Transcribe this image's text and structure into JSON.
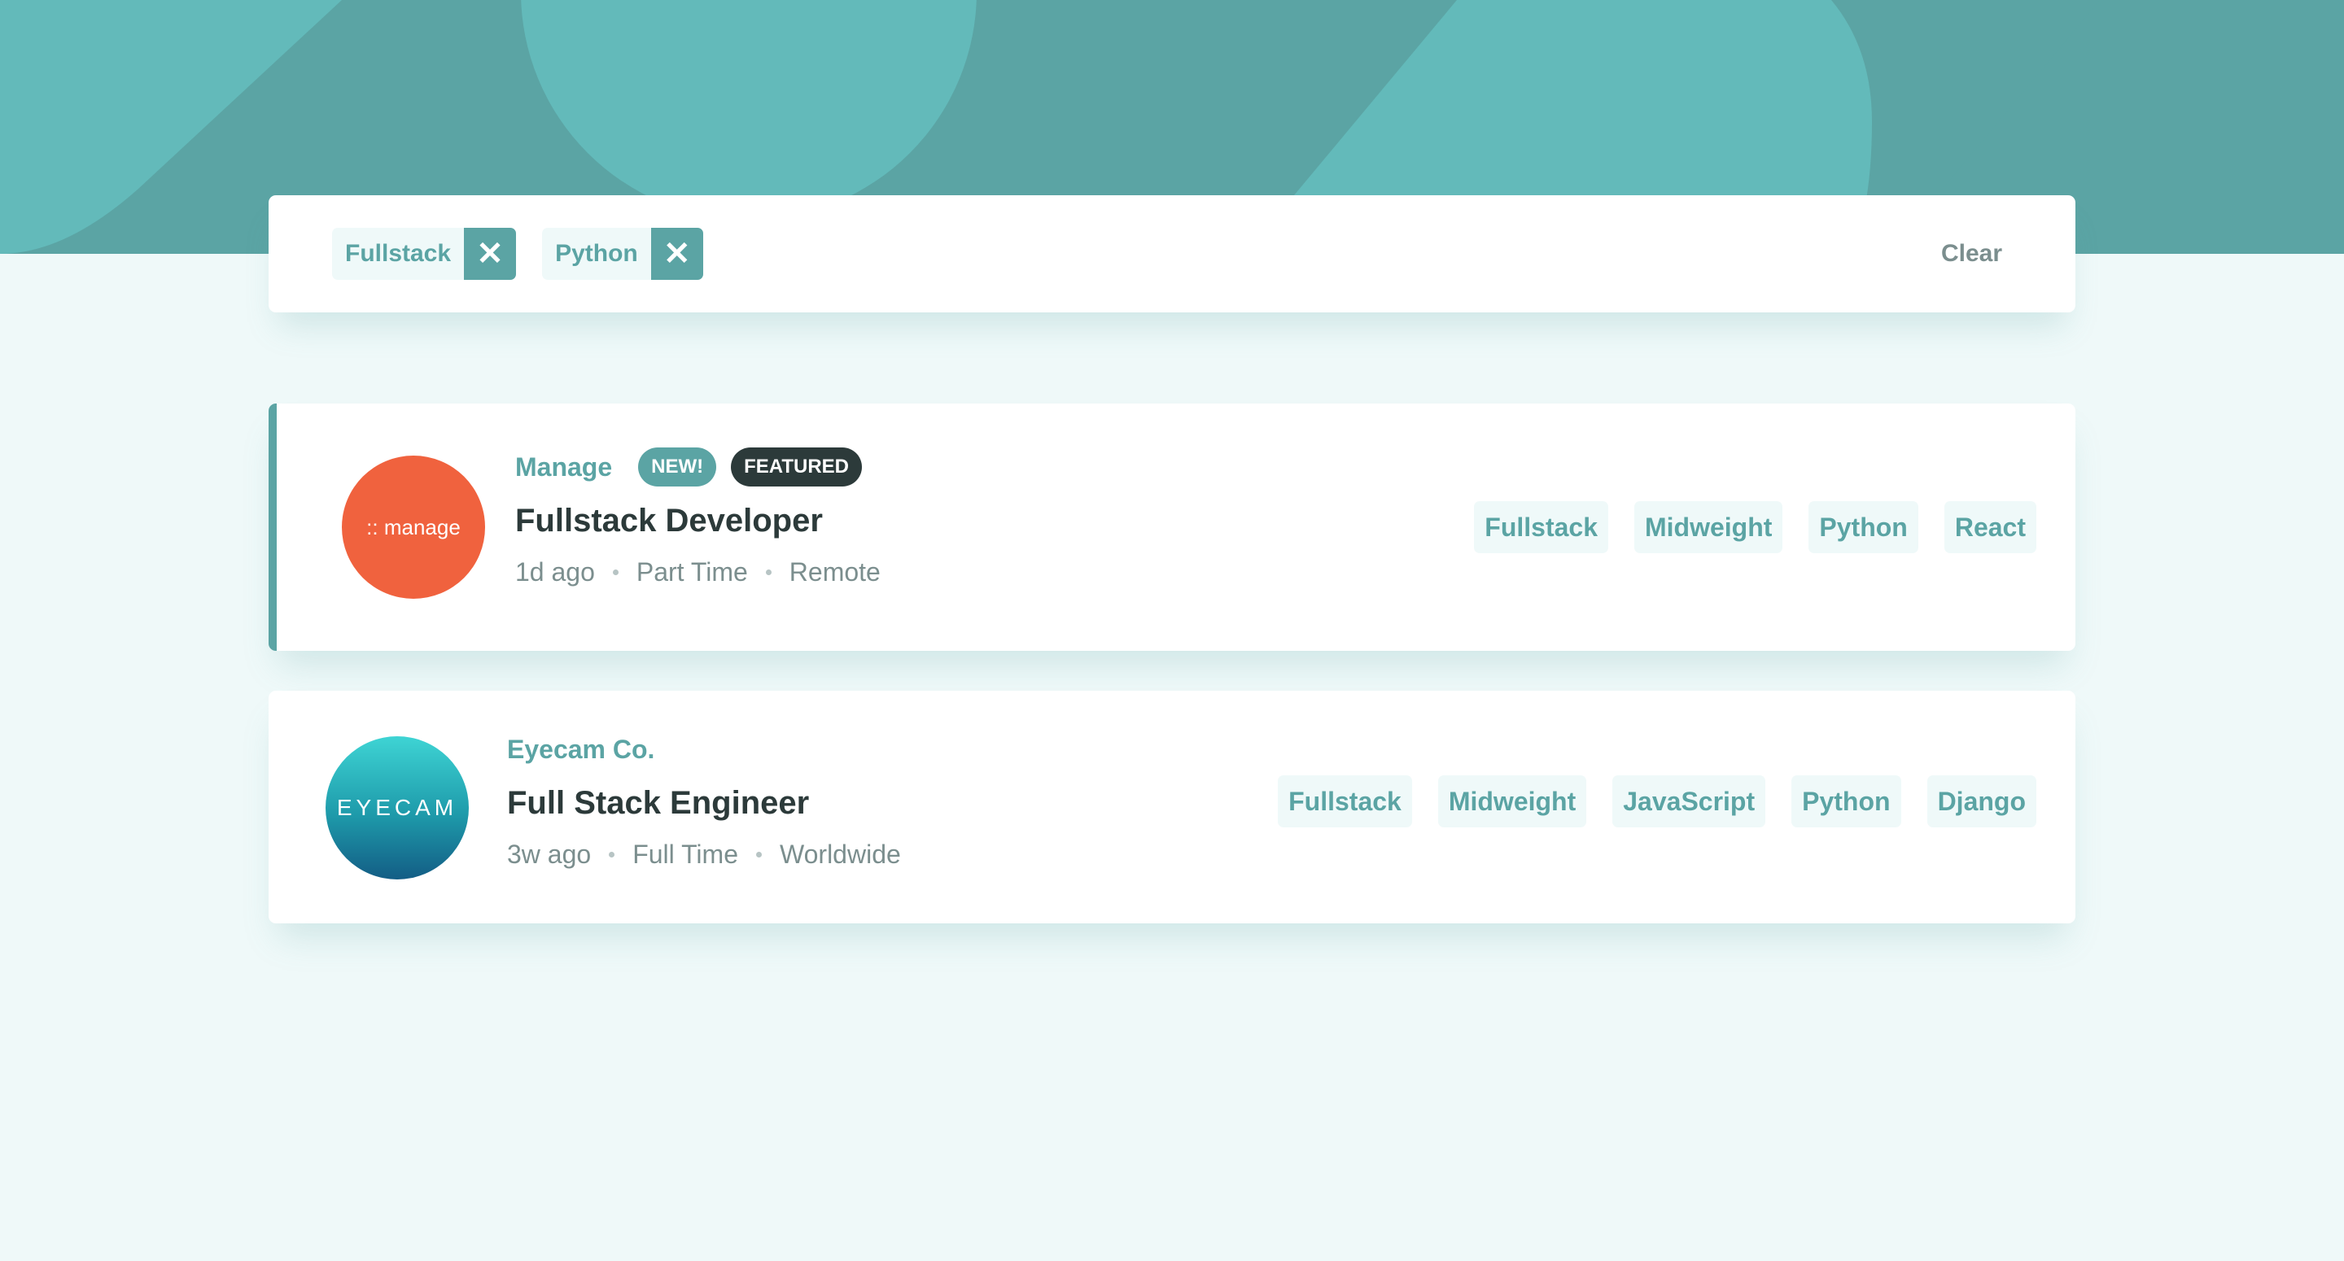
{
  "colors": {
    "primary": "#5ba4a4",
    "header_light": "#63baba",
    "background": "#eff9f9",
    "dark_text": "#2c3a3a",
    "muted_text": "#7b8e8e",
    "manage_brand": "#f0623e"
  },
  "filter_bar": {
    "chips": [
      {
        "label": "Fullstack",
        "remove_icon": "close-icon"
      },
      {
        "label": "Python",
        "remove_icon": "close-icon"
      }
    ],
    "remove_glyph": "✕",
    "clear_label": "Clear"
  },
  "jobs": [
    {
      "company": "Manage",
      "logo_text": ":: manage",
      "new_badge": "NEW!",
      "featured_badge": "FEATURED",
      "position": "Fullstack Developer",
      "posted_at": "1d ago",
      "contract": "Part Time",
      "location": "Remote",
      "tags": [
        "Fullstack",
        "Midweight",
        "Python",
        "React"
      ]
    },
    {
      "company": "Eyecam Co.",
      "logo_text": "EYECAM",
      "position": "Full Stack Engineer",
      "posted_at": "3w ago",
      "contract": "Full Time",
      "location": "Worldwide",
      "tags": [
        "Fullstack",
        "Midweight",
        "JavaScript",
        "Python",
        "Django"
      ]
    }
  ]
}
